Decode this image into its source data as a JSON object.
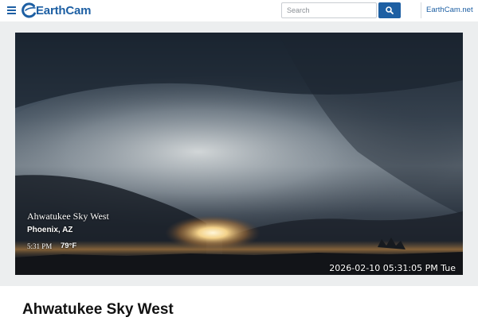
{
  "header": {
    "brand": "EarthCam",
    "search_placeholder": "Search",
    "site_link": "EarthCam.net"
  },
  "player": {
    "overlay_title": "Ahwatukee Sky West",
    "overlay_location": "Phoenix, AZ",
    "overlay_time": "5:31 PM",
    "overlay_temp": "79°F",
    "timestamp": "2026-02-10 05:31:05 PM Tue"
  },
  "page": {
    "title": "Ahwatukee Sky West"
  },
  "colors": {
    "brand_blue": "#1d5fa3",
    "stage_bg": "#eceeef"
  },
  "icons": {
    "menu": "hamburger-menu-icon",
    "logo": "earthcam-swoosh-logo",
    "search": "search-icon"
  }
}
